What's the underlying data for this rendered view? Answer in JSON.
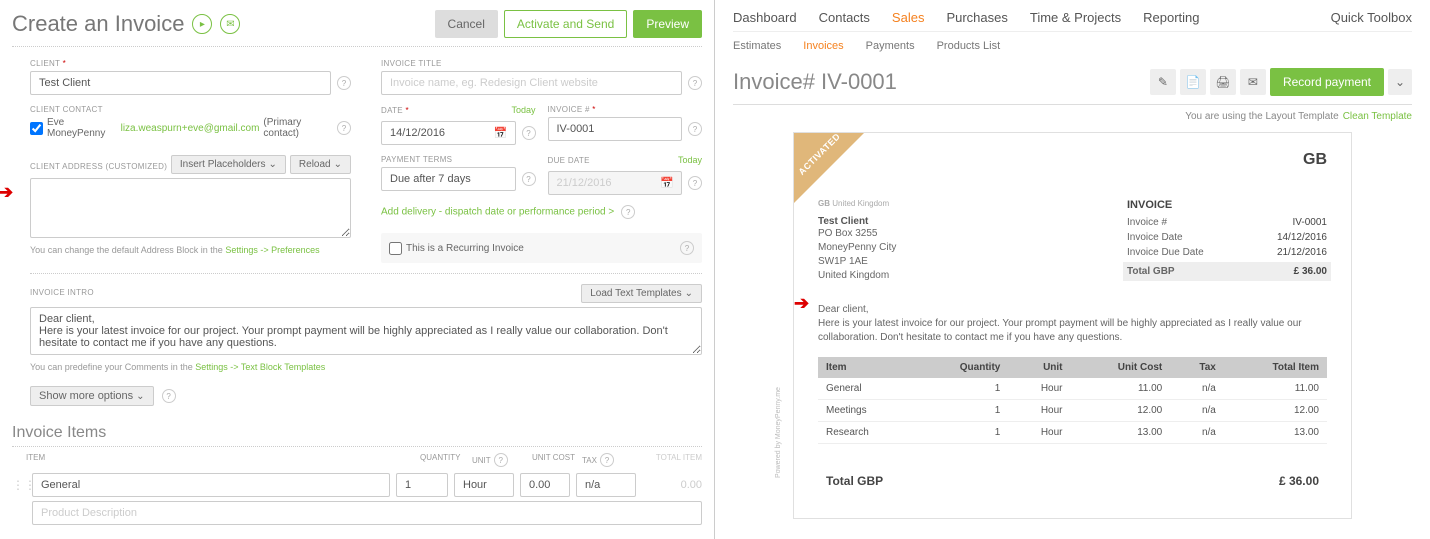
{
  "left": {
    "title": "Create an Invoice",
    "buttons": {
      "cancel": "Cancel",
      "activate": "Activate and Send",
      "preview": "Preview"
    },
    "client_label": "Client",
    "client_value": "Test Client",
    "titleField_label": "Invoice Title",
    "titleField_placeholder": "Invoice name, eg. Redesign Client website",
    "contact_label": "Client Contact",
    "contact_name": "Eve MoneyPenny",
    "contact_email": "liza.weaspurn+eve@gmail.com",
    "contact_suffix": "(Primary contact)",
    "date_label": "Date",
    "date_value": "14/12/2016",
    "today": "Today",
    "invoice_no_label": "Invoice #",
    "invoice_no_value": "IV-0001",
    "addr_label": "Client Address (Customized)",
    "insert_btn": "Insert Placeholders",
    "reload_btn": "Reload",
    "addr_hint_pre": "You can change the default Address Block in the ",
    "addr_hint_link": "Settings -> Preferences",
    "terms_label": "Payment Terms",
    "terms_value": "Due after 7 days",
    "due_label": "Due Date",
    "due_value": "21/12/2016",
    "delivery_link": "Add delivery - dispatch date or performance period >",
    "recurring_label": "This is a Recurring Invoice",
    "intro_label": "Invoice Intro",
    "load_templates": "Load Text Templates",
    "intro_text": "Dear client,\nHere is your latest invoice for our project. Your prompt payment will be highly appreciated as I really value our collaboration. Don't hesitate to contact me if you have any questions.",
    "comments_hint_pre": "You can predefine your Comments in the ",
    "comments_hint_link": "Settings -> Text Block Templates",
    "more_options": "Show more options",
    "items_heading": "Invoice Items",
    "th": {
      "item": "Item",
      "qty": "Quantity",
      "unit": "Unit",
      "ucost": "Unit Cost",
      "tax": "Tax",
      "total": "Total Item"
    },
    "row1": {
      "item": "General",
      "qty": "1",
      "unit": "Hour",
      "ucost": "0.00",
      "tax": "n/a",
      "total": "0.00"
    },
    "desc_placeholder": "Product Description"
  },
  "right": {
    "nav1": [
      "Dashboard",
      "Contacts",
      "Sales",
      "Purchases",
      "Time & Projects",
      "Reporting"
    ],
    "toolbox": "Quick Toolbox",
    "nav2": [
      "Estimates",
      "Invoices",
      "Payments",
      "Products List"
    ],
    "title": "Invoice# IV-0001",
    "record_btn": "Record payment",
    "template_note_pre": "You are using the Layout Template ",
    "template_note_link": "Clean Template",
    "ribbon": "ACTIVATED",
    "gb": "GB",
    "from_gb_prefix": "GB",
    "from_gb_suffix": "United Kingdom",
    "client_name": "Test Client",
    "addr": [
      "PO Box 3255",
      "MoneyPenny City",
      "SW1P 1AE",
      "United Kingdom"
    ],
    "summary_title": "INVOICE",
    "summary": [
      {
        "k": "Invoice #",
        "v": "IV-0001"
      },
      {
        "k": "Invoice Date",
        "v": "14/12/2016"
      },
      {
        "k": "Invoice Due Date",
        "v": "21/12/2016"
      }
    ],
    "summary_total": {
      "k": "Total GBP",
      "v": "£ 36.00"
    },
    "message_greeting": "Dear client,",
    "message_body": "Here is your latest invoice for our project. Your prompt payment will be highly appreciated as I really value our collaboration. Don't hesitate to contact me if you have any questions.",
    "th": {
      "item": "Item",
      "qty": "Quantity",
      "unit": "Unit",
      "ucost": "Unit Cost",
      "tax": "Tax",
      "total": "Total Item"
    },
    "items": [
      {
        "item": "General",
        "qty": "1",
        "unit": "Hour",
        "ucost": "11.00",
        "tax": "n/a",
        "total": "11.00"
      },
      {
        "item": "Meetings",
        "qty": "1",
        "unit": "Hour",
        "ucost": "12.00",
        "tax": "n/a",
        "total": "12.00"
      },
      {
        "item": "Research",
        "qty": "1",
        "unit": "Hour",
        "ucost": "13.00",
        "tax": "n/a",
        "total": "13.00"
      }
    ],
    "total_label": "Total GBP",
    "total_value": "£ 36.00",
    "powered": "Powered by MoneyPenny.me"
  }
}
